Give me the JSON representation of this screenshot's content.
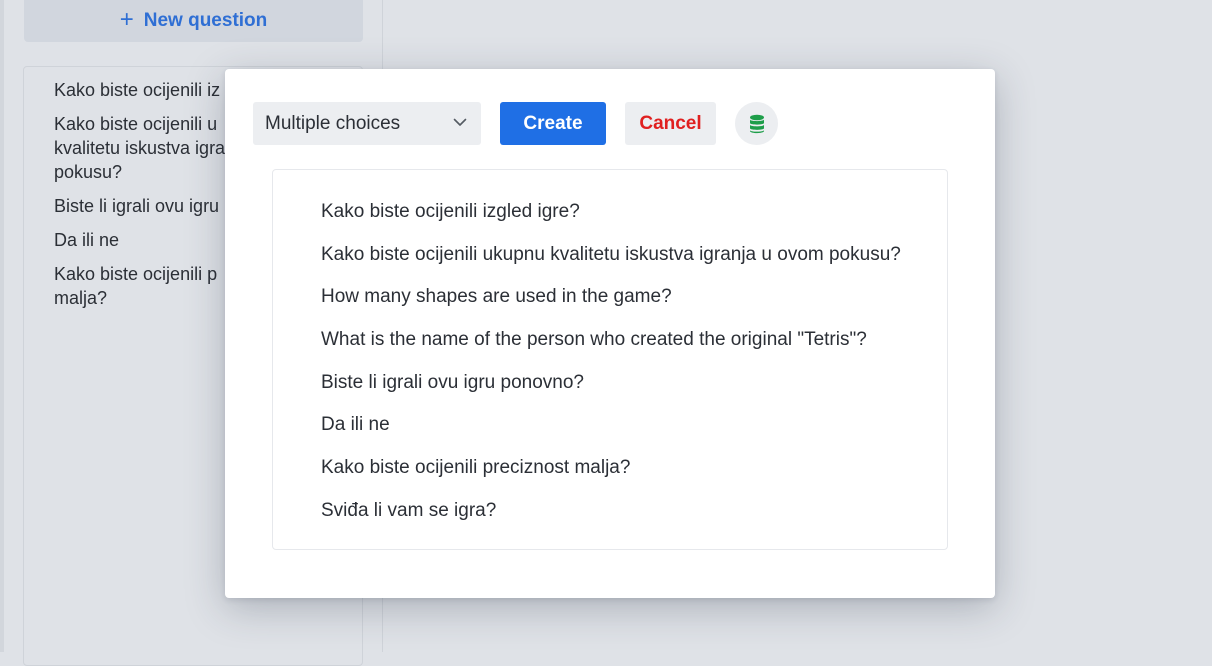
{
  "sidebar": {
    "new_question_label": "New question",
    "questions": [
      "Kako biste ocijenili iz",
      "Kako biste ocijenili u\nkvalitetu iskustva igra\npokusu?",
      "Biste li igrali ovu igru",
      "Da ili ne",
      "Kako biste ocijenili p\nmalja?"
    ]
  },
  "modal": {
    "type_select_value": "Multiple choices",
    "create_label": "Create",
    "cancel_label": "Cancel",
    "options": [
      "Kako biste ocijenili izgled igre?",
      "Kako biste ocijenili ukupnu kvalitetu iskustva igranja u ovom pokusu?",
      "How many shapes are used in the game?",
      "What is the name of the person who created the original \"Tetris\"?",
      "Biste li igrali ovu igru ponovno?",
      "Da ili ne",
      "Kako biste ocijenili preciznost malja?",
      "Sviđa li vam se igra?"
    ]
  },
  "icons": {
    "new_question": "plus-icon",
    "type_select": "chevron-down-icon",
    "database": "database-icon"
  },
  "colors": {
    "accent_blue": "#1f6fe5",
    "link_blue": "#2f6fd4",
    "cancel_red": "#e02020",
    "db_green": "#1e9e4a"
  }
}
